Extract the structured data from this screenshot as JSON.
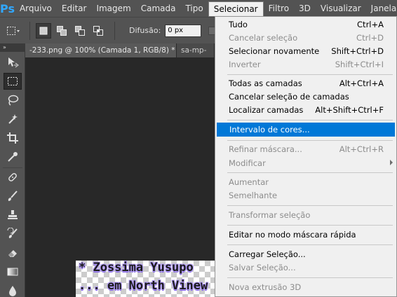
{
  "app": {
    "logo": "Ps",
    "accent": "#31a8ff",
    "highlight": "#0078d7"
  },
  "menubar": {
    "items": [
      {
        "label": "Arquivo"
      },
      {
        "label": "Editar"
      },
      {
        "label": "Imagem"
      },
      {
        "label": "Camada"
      },
      {
        "label": "Tipo"
      },
      {
        "label": "Selecionar",
        "active": true
      },
      {
        "label": "Filtro"
      },
      {
        "label": "3D"
      },
      {
        "label": "Visualizar"
      },
      {
        "label": "Janela"
      }
    ]
  },
  "options": {
    "difusao_label": "Difusão:",
    "difusao_value": "0 px"
  },
  "tools_header": "»",
  "tools": [
    {
      "icon": "move-tool-icon"
    },
    {
      "icon": "rectangular-marquee-tool-icon",
      "selected": true
    },
    {
      "icon": "lasso-tool-icon"
    },
    {
      "icon": "magic-wand-tool-icon"
    },
    {
      "icon": "crop-tool-icon"
    },
    {
      "icon": "eyedropper-tool-icon"
    },
    {
      "icon": "healing-brush-tool-icon"
    },
    {
      "icon": "brush-tool-icon"
    },
    {
      "icon": "clone-stamp-tool-icon"
    },
    {
      "icon": "history-brush-tool-icon"
    },
    {
      "icon": "eraser-tool-icon"
    },
    {
      "icon": "gradient-tool-icon"
    },
    {
      "icon": "blur-tool-icon"
    }
  ],
  "tabs": [
    {
      "label": "-233.png @ 100% (Camada 1, RGB/8) *",
      "close": "×",
      "active": true
    },
    {
      "label": "sa-mp-",
      "close": "",
      "active": false
    }
  ],
  "document": {
    "line1": "* Zossima Yusupo",
    "line2": "... em North Vinew"
  },
  "selecionar_menu": {
    "items": [
      {
        "label": "Tudo",
        "shortcut": "Ctrl+A",
        "enabled": true
      },
      {
        "label": "Cancelar seleção",
        "shortcut": "Ctrl+D",
        "enabled": false
      },
      {
        "label": "Selecionar novamente",
        "shortcut": "Shift+Ctrl+D",
        "enabled": true
      },
      {
        "label": "Inverter",
        "shortcut": "Shift+Ctrl+I",
        "enabled": false
      },
      {
        "label": "Todas as camadas",
        "shortcut": "Alt+Ctrl+A",
        "enabled": true
      },
      {
        "label": "Cancelar seleção de camadas",
        "shortcut": "",
        "enabled": true
      },
      {
        "label": "Localizar camadas",
        "shortcut": "Alt+Shift+Ctrl+F",
        "enabled": true
      },
      {
        "label": "Intervalo de cores...",
        "shortcut": "",
        "enabled": true,
        "highlighted": true
      },
      {
        "label": "Refinar máscara...",
        "shortcut": "Alt+Ctrl+R",
        "enabled": false
      },
      {
        "label": "Modificar",
        "shortcut": "",
        "enabled": false,
        "submenu": true
      },
      {
        "label": "Aumentar",
        "shortcut": "",
        "enabled": false
      },
      {
        "label": "Semelhante",
        "shortcut": "",
        "enabled": false
      },
      {
        "label": "Transformar seleção",
        "shortcut": "",
        "enabled": false
      },
      {
        "label": "Editar no modo máscara rápida",
        "shortcut": "",
        "enabled": true
      },
      {
        "label": "Carregar Seleção...",
        "shortcut": "",
        "enabled": true
      },
      {
        "label": "Salvar Seleção...",
        "shortcut": "",
        "enabled": false
      },
      {
        "label": "Nova extrusão 3D",
        "shortcut": "",
        "enabled": false
      }
    ]
  }
}
